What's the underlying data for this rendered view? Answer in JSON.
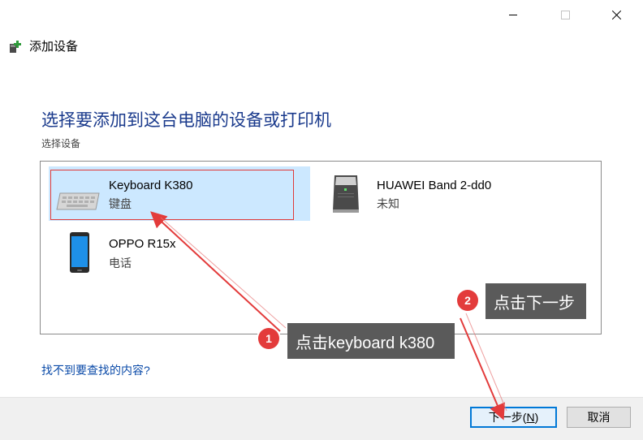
{
  "window": {
    "title": "添加设备",
    "controls": {
      "minimize": "minimize",
      "maximize": "maximize",
      "close": "close"
    }
  },
  "main": {
    "heading": "选择要添加到这台电脑的设备或打印机",
    "subheading": "选择设备",
    "devices": [
      {
        "name": "Keyboard K380",
        "type": "键盘",
        "icon": "keyboard-icon",
        "selected": true
      },
      {
        "name": "HUAWEI Band 2-dd0",
        "type": "未知",
        "icon": "computer-tower-icon",
        "selected": false
      },
      {
        "name": "OPPO R15x",
        "type": "电话",
        "icon": "phone-icon",
        "selected": false
      }
    ],
    "help_link": "找不到要查找的内容?"
  },
  "footer": {
    "next_label": "下一步(N)",
    "next_mnemonic": "N",
    "cancel_label": "取消"
  },
  "annotations": [
    {
      "number": "1",
      "text": "点击keyboard k380"
    },
    {
      "number": "2",
      "text": "点击下一步"
    }
  ],
  "colors": {
    "heading": "#1a3a8c",
    "selected_tile": "#cce8ff",
    "link": "#0a4aa8",
    "annotation_red": "#e33b3b",
    "callout_bg": "#5a5a5a",
    "primary_button_border": "#0078d7"
  }
}
